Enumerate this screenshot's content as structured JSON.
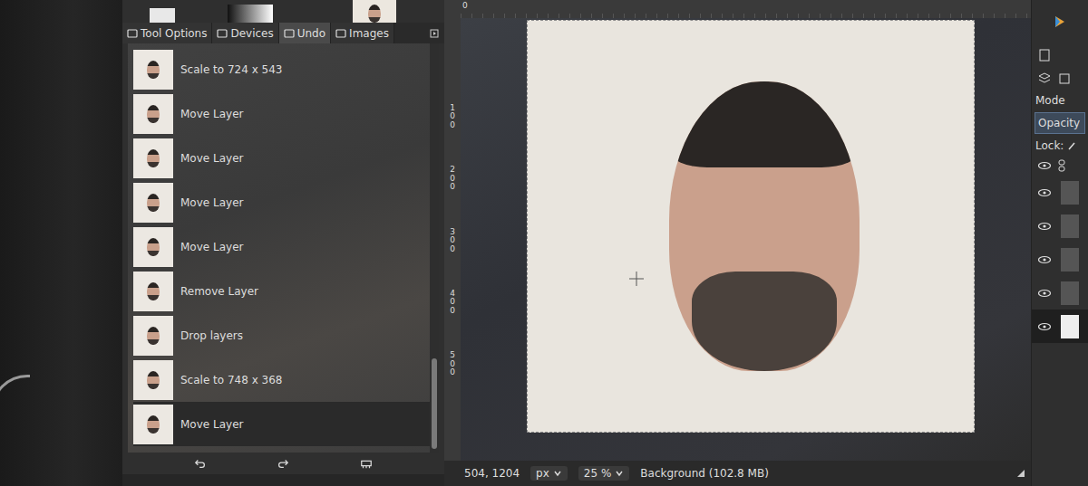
{
  "dock_tabs": [
    {
      "label": "Tool Options",
      "selected": false
    },
    {
      "label": "Devices",
      "selected": false
    },
    {
      "label": "Undo",
      "selected": true
    },
    {
      "label": "Images",
      "selected": false
    }
  ],
  "undo_history": [
    {
      "label": "Scale to 724 x 543",
      "selected": false
    },
    {
      "label": "Move Layer",
      "selected": false
    },
    {
      "label": "Move Layer",
      "selected": false
    },
    {
      "label": "Move Layer",
      "selected": false
    },
    {
      "label": "Move Layer",
      "selected": false
    },
    {
      "label": "Remove Layer",
      "selected": false
    },
    {
      "label": "Drop layers",
      "selected": false
    },
    {
      "label": "Scale to 748 x 368",
      "selected": false
    },
    {
      "label": "Move Layer",
      "selected": true
    }
  ],
  "rulers": {
    "horizontal": [
      "0"
    ],
    "vertical": [
      "100",
      "200",
      "300",
      "400",
      "500"
    ]
  },
  "status_bar": {
    "coordinates": "504, 1204",
    "unit": "px",
    "zoom": "25 %",
    "layer_info": "Background (102.8 MB)"
  },
  "layers_panel": {
    "mode_label": "Mode",
    "opacity_label": "Opacity",
    "lock_label": "Lock:",
    "layers": [
      {
        "visible": true,
        "selected": false
      },
      {
        "visible": true,
        "selected": false
      },
      {
        "visible": true,
        "selected": false
      },
      {
        "visible": true,
        "selected": false
      },
      {
        "visible": true,
        "selected": true
      }
    ]
  }
}
